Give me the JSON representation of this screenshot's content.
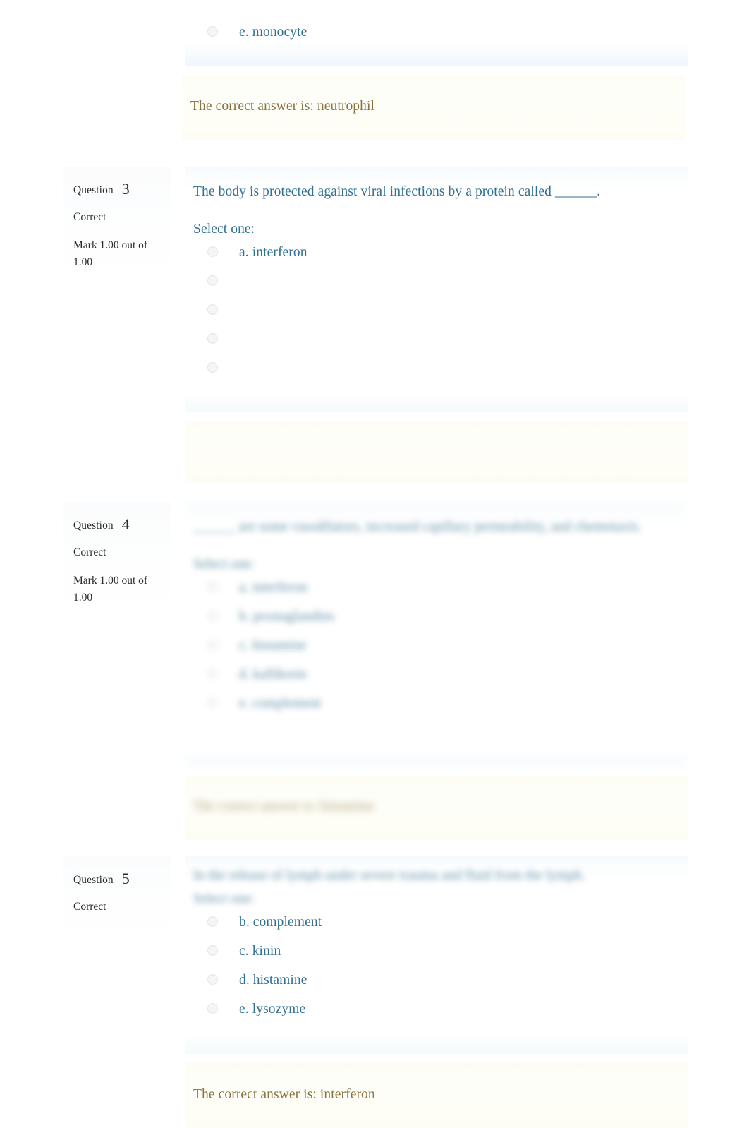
{
  "page": {
    "type": "moodle-quiz-review",
    "accent_text_color": "#31708f",
    "feedback_text_color": "#8a7340",
    "info_text_color": "#2b2b2b"
  },
  "labels": {
    "question_word": "Question",
    "select_one": "Select one:",
    "state_correct": "Correct"
  },
  "question2_tail": {
    "visible_answer": {
      "letter_text": "e. monocyte",
      "selected": false
    },
    "feedback": "The correct answer is: neutrophil"
  },
  "questions": [
    {
      "number": "3",
      "state": "Correct",
      "grade": "Mark 1.00 out of 1.00",
      "text": "The body is protected against viral infections by a protein called ______.",
      "select_one": "Select one:",
      "blurred": false,
      "answers": [
        {
          "label": "a. interferon",
          "hidden": false
        },
        {
          "label": "",
          "hidden": true
        },
        {
          "label": "",
          "hidden": true
        },
        {
          "label": "",
          "hidden": true
        },
        {
          "label": "",
          "hidden": true
        }
      ],
      "feedback": ""
    },
    {
      "number": "4",
      "state": "Correct",
      "grade": "Mark 1.00 out of 1.00",
      "text": "______ are some vasodilators, increased capillary permeability, and chemotaxis.",
      "select_one": "Select one:",
      "blurred": true,
      "answers": [
        {
          "label": "a. interferon",
          "hidden": false
        },
        {
          "label": "b. prostaglandins",
          "hidden": false
        },
        {
          "label": "c. histamine",
          "hidden": false
        },
        {
          "label": "d. kallikrein",
          "hidden": false
        },
        {
          "label": "e. complement",
          "hidden": false
        }
      ],
      "feedback": "The correct answer is: histamine"
    },
    {
      "number": "5",
      "state": "Correct",
      "grade": "",
      "text": "In the release of lymph under severe trauma and fluid from the lymph.",
      "select_one": "Select one:",
      "blurred": true,
      "question_blurred_only": true,
      "answers": [
        {
          "label": "b. complement",
          "hidden": false
        },
        {
          "label": "c. kinin",
          "hidden": false
        },
        {
          "label": "d. histamine",
          "hidden": false
        },
        {
          "label": "e. lysozyme",
          "hidden": false
        }
      ],
      "feedback": "The correct answer is: interferon"
    }
  ]
}
